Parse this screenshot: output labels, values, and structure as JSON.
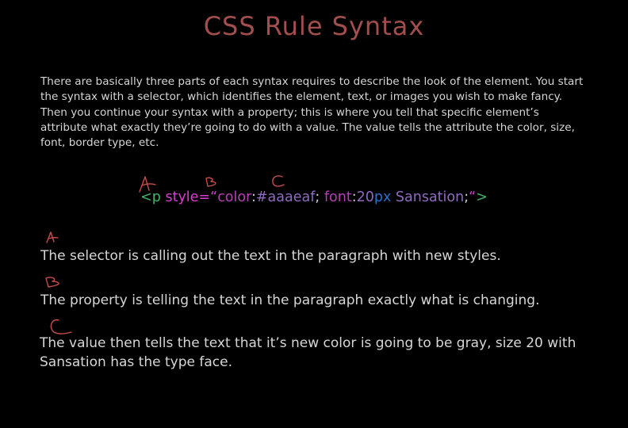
{
  "title": "CSS Rule Syntax",
  "intro_text": "There are basically three parts of each syntax requires to describe the look of the element. You start the syntax with a selector, which identifies the element, text, or images you wish to make fancy. Then you continue your syntax with a property; this is where you tell that specific element’s attribute what exactly they’re going to do with a value. The value tells the attribute the color, size, font, border type, etc.",
  "code_example": {
    "open_tag": "<p ",
    "attr_name": "style=",
    "quote_open": "“",
    "prop1": "color",
    "colon1": ":",
    "val1": "#aaaeaf",
    "semi1": "; ",
    "prop2": "font",
    "colon2": ":",
    "val2_num": "20",
    "val2_unit": "px",
    "val2_font": " Sansation",
    "semi2": ";",
    "quote_close": "“",
    "close_tag": ">"
  },
  "code_colors": {
    "tag": "#3fb36b",
    "attr": "#d83cd3",
    "prop": "#b63fb7",
    "value": "#8f6bc0",
    "px": "#2c6fc9",
    "punct": "#cccccc",
    "quote": "#d83cd3"
  },
  "annotation_color": "#c94c4c",
  "explanations": {
    "selector": "The selector is calling out the text in the paragraph with new styles.",
    "property": "The property is telling the text in the paragraph exactly what is changing.",
    "value": "The value then tells the text that it’s new color is going to be gray, size 20 with Sansation has the type face."
  }
}
